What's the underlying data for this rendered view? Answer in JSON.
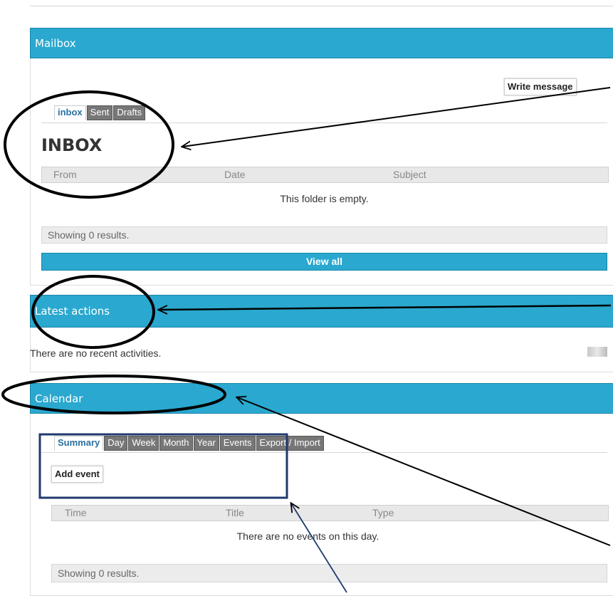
{
  "mailbox": {
    "title": "Mailbox",
    "write_message": "Write message",
    "tabs": [
      "inbox",
      "Sent",
      "Drafts"
    ],
    "folder_title": "INBOX",
    "columns": [
      "From",
      "Date",
      "Subject"
    ],
    "empty_text": "This folder is empty.",
    "showing": "Showing 0 results.",
    "view_all": "View all"
  },
  "latest_actions": {
    "title": "Latest actions",
    "empty_text": "There are no recent activities."
  },
  "calendar": {
    "title": "Calendar",
    "tabs": [
      "Summary",
      "Day",
      "Week",
      "Month",
      "Year",
      "Events",
      "Export / Import"
    ],
    "add_event": "Add event",
    "columns": [
      "Time",
      "Title",
      "Type"
    ],
    "empty_text": "There are no events on this day.",
    "showing": "Showing 0 results."
  },
  "colors": {
    "header_blue": "#2aa8cf",
    "active_tab_text": "#2a6f9e",
    "annotation": "#000000",
    "highlight_box": "#1f3a6e"
  }
}
